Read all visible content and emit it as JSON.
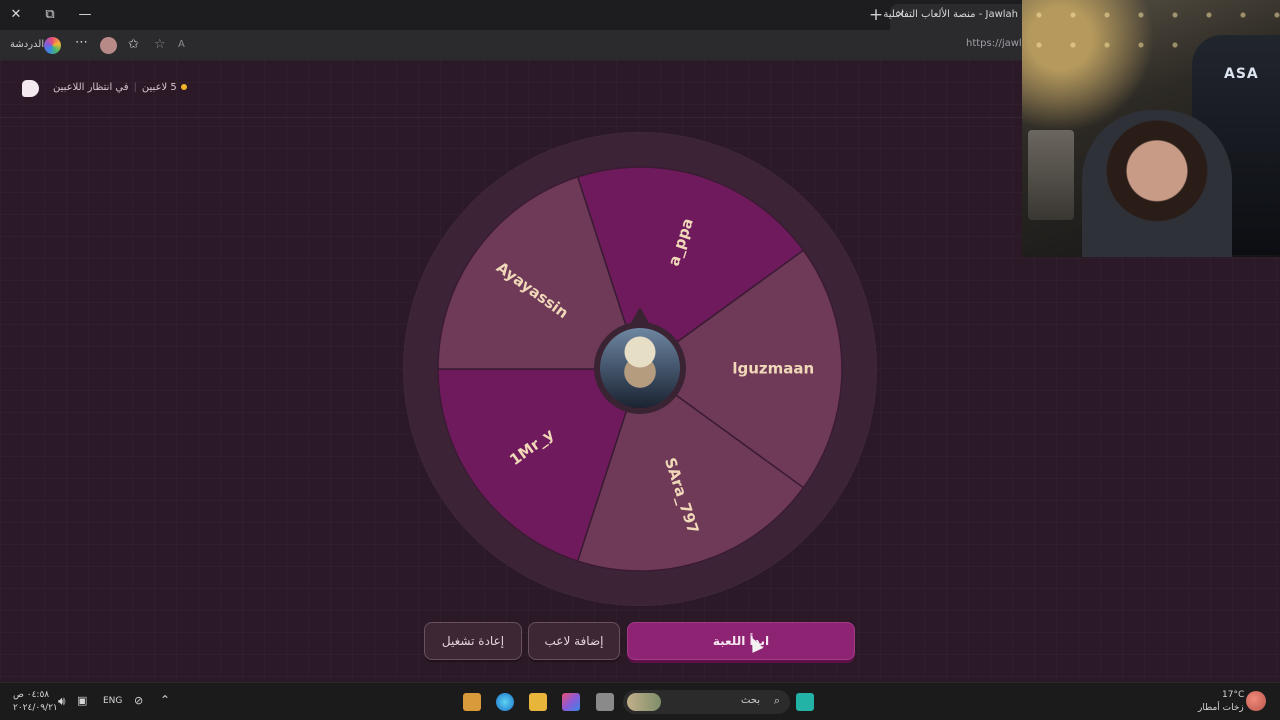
{
  "browser": {
    "tab_title": "Jawlah - منصة الألعاب التفاعلية",
    "url": "https://jawlah",
    "copilot_label": "الدردشة",
    "read_aloud_label": "A"
  },
  "header": {
    "players_count": "5 لاعبين",
    "waiting_text": "في انتظار اللاعبين"
  },
  "wheel": {
    "players": [
      {
        "name": "a_ppa",
        "color": "#6e1a5c"
      },
      {
        "name": "lguzmaan",
        "color": "#6f3a58"
      },
      {
        "name": "SAra_797",
        "color": "#6f3a58"
      },
      {
        "name": "1Mr_y",
        "color": "#6e1a5c"
      },
      {
        "name": "Ayayassin",
        "color": "#6f3a58"
      }
    ],
    "label_color": "#f0d8b8"
  },
  "buttons": {
    "restart": "إعادة تشغيل",
    "add_player": "إضافة لاعب",
    "start": "ابدأ اللعبة"
  },
  "webcam": {
    "overlay_logo": "ASA"
  },
  "taskbar": {
    "time": "٠٤:٥٨ ص",
    "date": "٢٠٢٤/٠٩/٢١",
    "language": "ENG",
    "search_placeholder": "بحث",
    "temperature": "17°C",
    "weather": "زخات أمطار"
  },
  "colors": {
    "page_bg": "#2b1927",
    "accent": "#8e2374",
    "status_dot": "#f1b32a"
  }
}
